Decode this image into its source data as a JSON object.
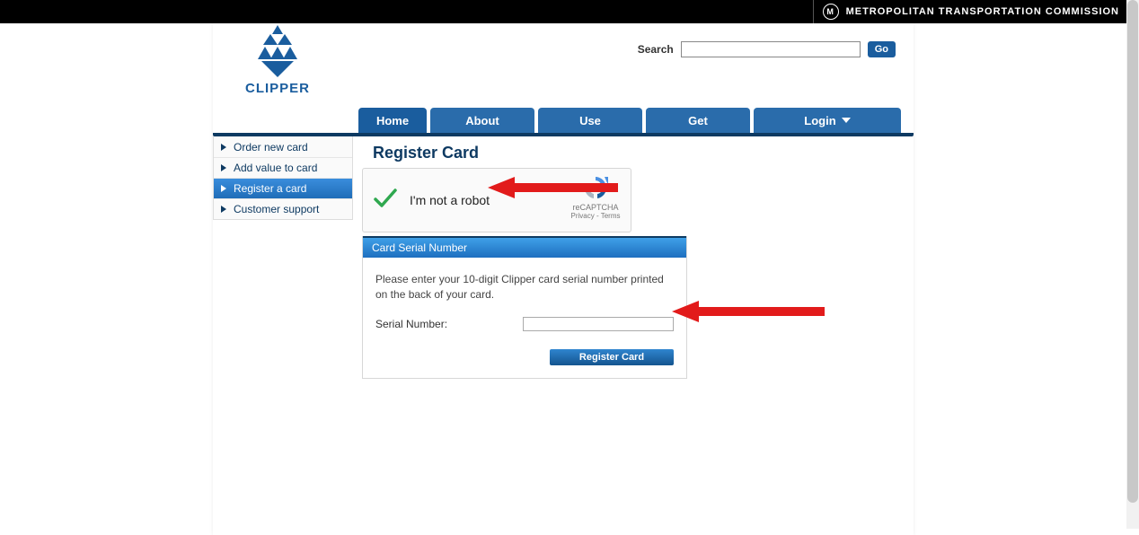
{
  "topbar": {
    "org_text": "METROPOLITAN TRANSPORTATION COMMISSION",
    "icon_letter": "M"
  },
  "logo": {
    "text": "CLIPPER"
  },
  "search": {
    "label": "Search",
    "go": "Go"
  },
  "nav": {
    "home": "Home",
    "about": "About",
    "use": "Use",
    "get": "Get",
    "login": "Login"
  },
  "sidebar": {
    "items": [
      {
        "label": "Order new card"
      },
      {
        "label": "Add value to card"
      },
      {
        "label": "Register a card"
      },
      {
        "label": "Customer support"
      }
    ],
    "active_index": 2
  },
  "main": {
    "title": "Register Card",
    "captcha": {
      "text": "I'm not a robot",
      "brand": "reCAPTCHA",
      "links": "Privacy - Terms"
    },
    "panel": {
      "header": "Card Serial Number",
      "instruction": "Please enter your 10-digit Clipper card serial number printed on the back of your card.",
      "field_label": "Serial Number:",
      "button": "Register Card"
    }
  }
}
